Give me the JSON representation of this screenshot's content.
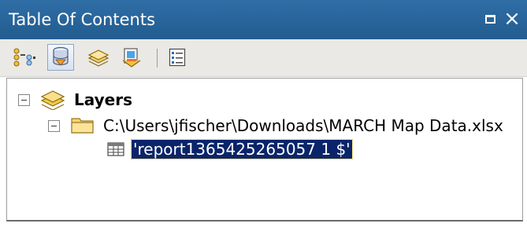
{
  "window": {
    "title": "Table Of Contents"
  },
  "titlebar_buttons": {
    "restore_icon": "restore-window-icon",
    "close_label": "×"
  },
  "toolbar": {
    "tools": [
      {
        "name": "list-by-drawing-order",
        "icon": "drawing-order-icon",
        "active": false
      },
      {
        "name": "list-by-source",
        "icon": "database-source-icon",
        "active": true
      },
      {
        "name": "list-by-visibility",
        "icon": "layers-visibility-icon",
        "active": false
      },
      {
        "name": "list-by-selection",
        "icon": "selection-icon",
        "active": false
      },
      {
        "name": "options",
        "icon": "options-list-icon",
        "active": false
      }
    ]
  },
  "tree": {
    "root": {
      "label": "Layers",
      "expanded": true,
      "icon": "layers-icon"
    },
    "folder": {
      "label": "C:\\Users\\jfischer\\Downloads\\MARCH Map Data.xlsx",
      "expanded": true,
      "icon": "folder-icon"
    },
    "table": {
      "label": "'report1365425265057 1 $'",
      "selected": true,
      "icon": "table-icon"
    }
  },
  "colors": {
    "titlebar": "#2a6599",
    "toolbar": "#ebe9e5",
    "selection": "#0a246a"
  }
}
